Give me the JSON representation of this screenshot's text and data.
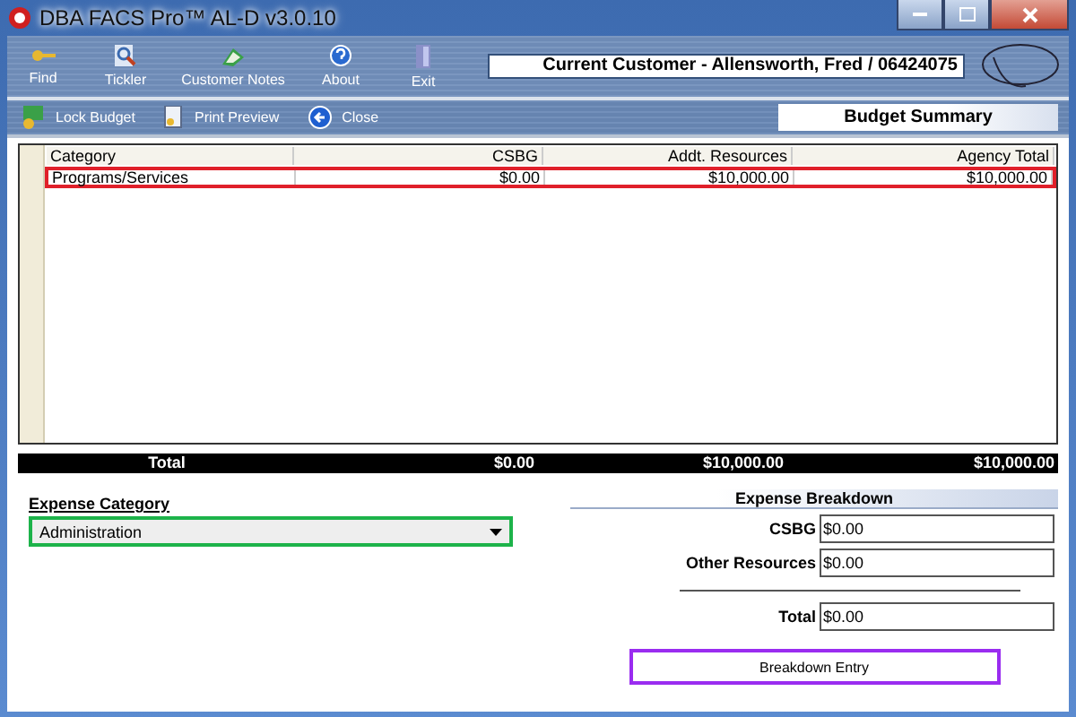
{
  "window": {
    "title": "DBA FACS Pro™ AL-D v3.0.10"
  },
  "toolbar": [
    {
      "label": "Find",
      "kind": "find"
    },
    {
      "label": "Tickler",
      "kind": "tickler"
    },
    {
      "label": "Customer Notes",
      "kind": "notes"
    },
    {
      "label": "About",
      "kind": "about"
    },
    {
      "label": "Exit",
      "kind": "exit"
    }
  ],
  "current_customer": "Current Customer - Allensworth, Fred / 06424075",
  "sub_toolbar": [
    {
      "label": "Lock Budget",
      "kind": "lock"
    },
    {
      "label": "Print Preview",
      "kind": "print"
    },
    {
      "label": "Close",
      "kind": "close"
    }
  ],
  "panel_title": "Budget Summary",
  "table": {
    "columns": [
      "Category",
      "CSBG",
      "Addt. Resources",
      "Agency Total"
    ],
    "rows": [
      {
        "cells": [
          "Programs/Services",
          "$0.00",
          "$10,000.00",
          "$10,000.00"
        ],
        "selected": true
      }
    ],
    "total": [
      "Total",
      "$0.00",
      "$10,000.00",
      "$10,000.00"
    ]
  },
  "expense_category": {
    "label": "Expense Category",
    "value": "Administration"
  },
  "expense_breakdown": {
    "title": "Expense Breakdown",
    "fields": [
      {
        "label": "CSBG",
        "value": "$0.00"
      },
      {
        "label": "Other Resources",
        "value": "$0.00"
      }
    ],
    "total": {
      "label": "Total",
      "value": "$0.00"
    },
    "button": "Breakdown Entry"
  }
}
